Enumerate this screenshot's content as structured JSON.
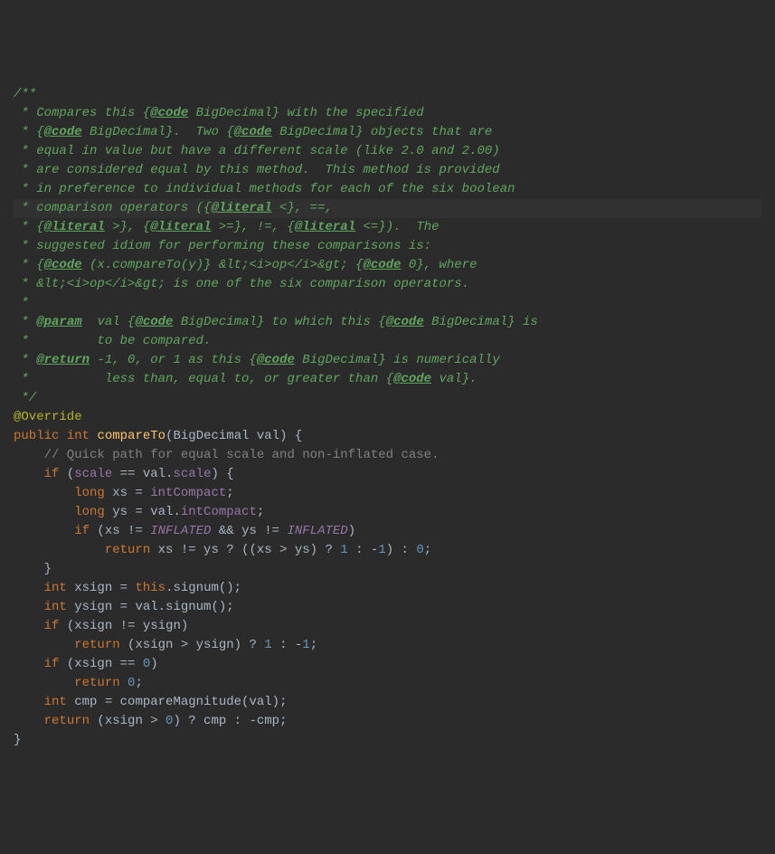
{
  "javadoc": {
    "open": "/**",
    "l1a": " * Compares this {",
    "l1_tag": "@code",
    "l1b": " BigDecimal} with the specified",
    "l2a": " * {",
    "l2_tag": "@code",
    "l2b": " BigDecimal}.  Two {",
    "l2_tag2": "@code",
    "l2c": " BigDecimal} objects that are",
    "l3": " * equal in value but have a different scale (like 2.0 and 2.00)",
    "l4": " * are considered equal by this method.  This method is provided",
    "l5": " * in preference to individual methods for each of the six boolean",
    "l6a": " * comparison operators ({",
    "l6_tag": "@literal",
    "l6b": " <}, ==,",
    "l7a": " * {",
    "l7_tag1": "@literal",
    "l7b": " >}, {",
    "l7_tag2": "@literal",
    "l7c": " >=}, !=, {",
    "l7_tag3": "@literal",
    "l7d": " <=}).  The",
    "l8": " * suggested idiom for performing these comparisons is:",
    "l9a": " * {",
    "l9_tag1": "@code",
    "l9b": " (x.compareTo(y)} &lt;<i>op</i>&gt; {",
    "l9_tag2": "@code",
    "l9c": " 0}, where",
    "l10": " * &lt;<i>op</i>&gt; is one of the six comparison operators.",
    "l11": " *",
    "l12a": " * ",
    "l12_tag": "@param",
    "l12b": "  val {",
    "l12_tag2": "@code",
    "l12c": " BigDecimal} to which this {",
    "l12_tag3": "@code",
    "l12d": " BigDecimal} is",
    "l13": " *         to be compared.",
    "l14a": " * ",
    "l14_tag": "@return",
    "l14b": " -1, 0, or 1 as this {",
    "l14_tag2": "@code",
    "l14c": " BigDecimal} is numerically",
    "l15a": " *          less than, equal to, or greater than {",
    "l15_tag": "@code",
    "l15b": " val}.",
    "close": " */"
  },
  "override": "@Override",
  "sig": {
    "public": "public",
    "int": "int",
    "name": "compareTo",
    "paren_open": "(",
    "ptype": "BigDecimal",
    "pname": " val",
    "rest": ") {"
  },
  "body": {
    "c1": "    // Quick path for equal scale and non-inflated case.",
    "if1a": "    ",
    "if1_kw": "if",
    "if1b": " (",
    "scale1": "scale",
    "if1c": " == val.",
    "scale2": "scale",
    "if1d": ") {",
    "xs_a": "        ",
    "long1": "long",
    "xs_b": " xs = ",
    "intCompact1": "intCompact",
    "xs_c": ";",
    "ys_a": "        ",
    "long2": "long",
    "ys_b": " ys = val.",
    "intCompact2": "intCompact",
    "ys_c": ";",
    "if2a": "        ",
    "if2_kw": "if",
    "if2b": " (xs != ",
    "infl1": "INFLATED",
    "if2c": " && ys != ",
    "infl2": "INFLATED",
    "if2d": ")",
    "ret1a": "            ",
    "ret1_kw": "return",
    "ret1b": " xs != ys ? ((xs > ys) ? ",
    "one1": "1",
    "ret1c": " : -",
    "one2": "1",
    "ret1d": ") : ",
    "zero1": "0",
    "ret1e": ";",
    "closebrace1": "    }",
    "xsign_a": "    ",
    "int_xsign": "int",
    "xsign_b": " xsign = ",
    "this_kw": "this",
    "xsign_c": ".signum();",
    "ysign_a": "    ",
    "int_ysign": "int",
    "ysign_b": " ysign = val.signum();",
    "if3a": "    ",
    "if3_kw": "if",
    "if3b": " (xsign != ysign)",
    "ret2a": "        ",
    "ret2_kw": "return",
    "ret2b": " (xsign > ysign) ? ",
    "one3": "1",
    "ret2c": " : -",
    "one4": "1",
    "ret2d": ";",
    "if4a": "    ",
    "if4_kw": "if",
    "if4b": " (xsign == ",
    "zero2": "0",
    "if4c": ")",
    "ret3a": "        ",
    "ret3_kw": "return",
    "ret3b": " ",
    "zero3": "0",
    "ret3c": ";",
    "cmp_a": "    ",
    "int_cmp": "int",
    "cmp_b": " cmp = compareMagnitude(val);",
    "ret4a": "    ",
    "ret4_kw": "return",
    "ret4b": " (xsign > ",
    "zero4": "0",
    "ret4c": ") ? cmp : -cmp;",
    "closebrace2": "}"
  }
}
